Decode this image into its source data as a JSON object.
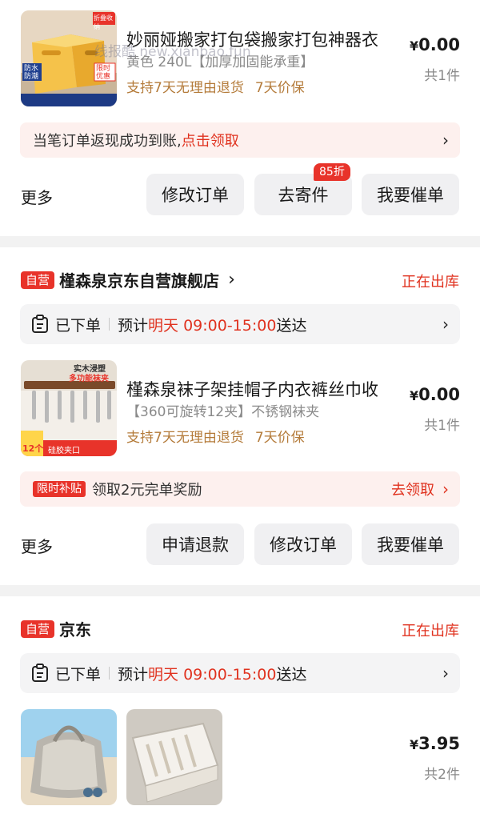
{
  "watermark": "线报酷 new.xianbao.fun",
  "order1": {
    "product": {
      "title": "妙丽娅搬家打包袋搬家打包神器衣",
      "spec": "黄色 240L【加厚加固能承重】",
      "guarantees": [
        "支持7天无理由退货",
        "7天价保"
      ],
      "price_symbol": "¥",
      "price_value": "0.00",
      "qty": "共1件",
      "img_labels": [
        "防水防潮",
        "限时优惠",
        "折叠收纳"
      ]
    },
    "banner": {
      "text": "当笔订单返现成功到账,",
      "link": "点击领取"
    },
    "more": "更多",
    "buttons": [
      "修改订单",
      "去寄件",
      "我要催单"
    ],
    "discount_badge": "85折"
  },
  "order2": {
    "store": {
      "badge": "自营",
      "name": "槿森泉京东自营旗舰店",
      "status": "正在出库"
    },
    "delivery": {
      "status": "已下单",
      "prefix": "预计",
      "when": "明天 09:00-15:00",
      "suffix": "送达"
    },
    "product": {
      "title": "槿森泉袜子架挂帽子内衣裤丝巾收",
      "spec": "【360可旋转12夹】不锈钢袜夹",
      "guarantees": [
        "支持7天无理由退货",
        "7天价保"
      ],
      "price_symbol": "¥",
      "price_value": "0.00",
      "qty": "共1件",
      "img_labels": [
        "实木浸塑",
        "多功能袜夹",
        "12个",
        "硅胶夹口"
      ]
    },
    "subsidy": {
      "tag": "限时补贴",
      "text": "领取2元完单奖励",
      "link": "去领取"
    },
    "more": "更多",
    "buttons": [
      "申请退款",
      "修改订单",
      "我要催单"
    ]
  },
  "order3": {
    "store": {
      "badge": "自营",
      "name": "京东",
      "status": "正在出库"
    },
    "delivery": {
      "status": "已下单",
      "prefix": "预计",
      "when": "明天 09:00-15:00",
      "suffix": "送达"
    },
    "price_symbol": "¥",
    "price_value": "3.95",
    "qty": "共2件"
  },
  "colors": {
    "accent_red": "#e0321f",
    "guarantee_gold": "#b47b3a",
    "banner_bg": "#fdf0ee"
  }
}
